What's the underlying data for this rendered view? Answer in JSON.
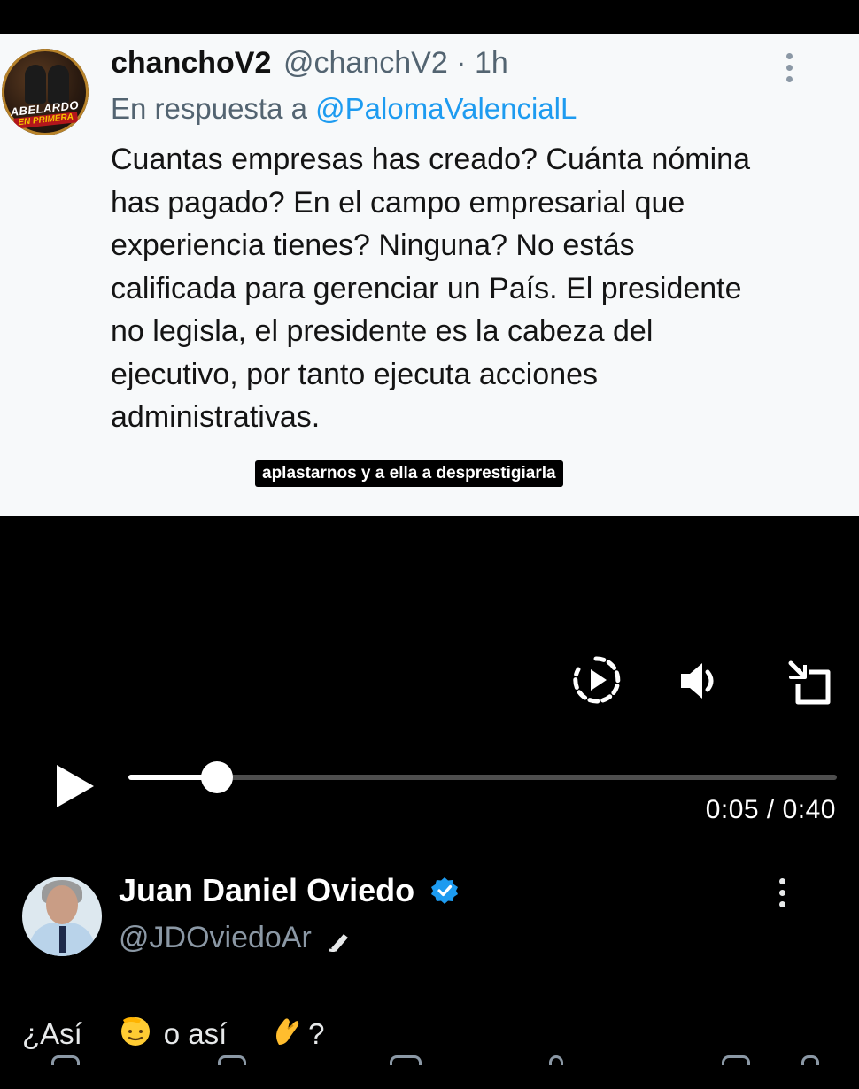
{
  "quoted_tweet": {
    "avatar_text_line1": "ABELARDO",
    "avatar_text_line2": "EN PRIMERA",
    "display_name": "chanchoV2",
    "meta": "@chanchV2 · 1h",
    "reply_prefix": "En respuesta a ",
    "reply_mention": "@PalomaValencialL",
    "body": "Cuantas empresas has creado? Cuánta nómina\nhas pagado? En el campo empresarial que\nexperiencia tienes?  Ninguna? No estás\ncalificada para gerenciar un País. El presidente\nno legisla, el presidente es la cabeza del\nejecutivo, por tanto ejecuta acciones\nadministrativas.",
    "more_icon": "more-vertical-icon"
  },
  "subtitle": "aplastarnos y a ella a desprestigiarla",
  "video": {
    "icons": [
      "replay-icon",
      "volume-icon",
      "exit-fullscreen-icon",
      "play-icon"
    ],
    "progress_fraction": 0.125,
    "time_readout": "0:05 / 0:40"
  },
  "post": {
    "author_name": "Juan Daniel Oviedo",
    "author_handle": "@JDOviedoAr",
    "text_before": "¿Así",
    "text_middle": " o así ",
    "text_after": "?",
    "emojis": [
      "saluting-face-emoji",
      "pinching-hand-emoji"
    ],
    "icons": [
      "verified-badge-icon",
      "edit-pencil-icon",
      "more-vertical-icon"
    ]
  },
  "colors": {
    "accent": "#1d9bf0",
    "secondary_text": "#536471",
    "background": "#000000",
    "frame_background": "#f7f9fa"
  }
}
